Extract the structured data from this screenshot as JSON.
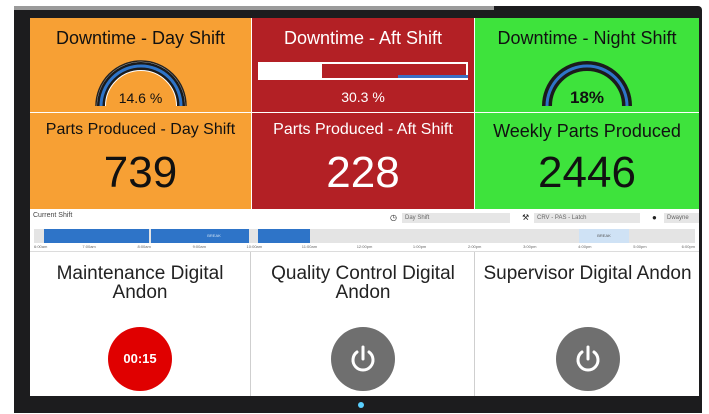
{
  "tiles": {
    "downtime_day": {
      "title": "Downtime - Day Shift",
      "value": "14.6 %",
      "fraction": 0.146
    },
    "downtime_aft": {
      "title": "Downtime - Aft Shift",
      "value": "30.3 %",
      "fraction": 0.303
    },
    "downtime_night": {
      "title": "Downtime - Night Shift",
      "value": "18%",
      "fraction": 0.18
    },
    "parts_day": {
      "title": "Parts Produced - Day Shift",
      "value": "739"
    },
    "parts_aft": {
      "title": "Parts Produced - Aft Shift",
      "value": "228"
    },
    "parts_weekly": {
      "title": "Weekly Parts Produced",
      "value": "2446"
    }
  },
  "timeline": {
    "label": "Current Shift",
    "shift_field": "Day Shift",
    "line_field": "CRV - PAS - Latch",
    "user_field": "Dwayne",
    "break_label": "BREAK",
    "ticks": [
      "6:00am",
      "7:00am",
      "8:00am",
      "9:00am",
      "10:00am",
      "11:00am",
      "12:00pm",
      "1:00pm",
      "2:00pm",
      "3:00pm",
      "4:00pm",
      "5:00pm",
      "6:00pm"
    ]
  },
  "andons": [
    {
      "title": "Maintenance Digital Andon",
      "state": "active",
      "timer": "00:15"
    },
    {
      "title": "Quality Control Digital Andon",
      "state": "idle"
    },
    {
      "title": "Supervisor Digital Andon",
      "state": "idle"
    }
  ],
  "colors": {
    "orange": "#f7a034",
    "red": "#b32025",
    "green": "#3ee33c",
    "andon_active": "#e00000",
    "andon_idle": "#6f6f6f",
    "timeline_blue": "#2e74c8"
  },
  "icons": [
    "clock-icon",
    "wrench-icon",
    "users-icon",
    "power-icon"
  ]
}
